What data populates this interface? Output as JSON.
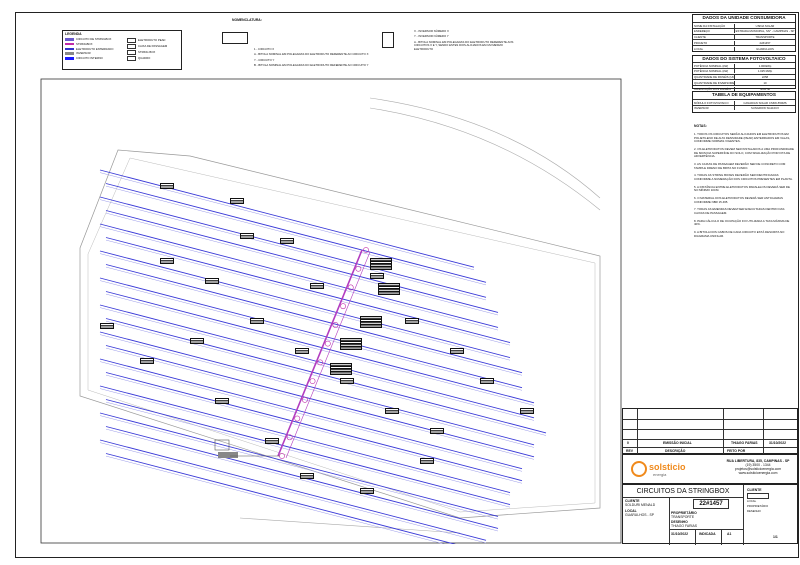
{
  "legend_left": {
    "title": "LEGENDA",
    "items": [
      {
        "color": "#6a5acd",
        "label": "CIRCUITO DE STRINGBOX"
      },
      {
        "color": "#c02aa8",
        "label": "STRINGBOX"
      },
      {
        "color": "#3333cc",
        "label": "ELETRODUTO ENTERRADO"
      },
      {
        "color": "#888888",
        "label": "INVERSOR"
      },
      {
        "color": "#1a1aff",
        "label": "CIRCUITO INTERNO"
      }
    ],
    "items_right": [
      "ELETRODUTO PEAD",
      "CAIXA DE PASSAGEM",
      "STRING BOX",
      "QUADRO"
    ]
  },
  "nomenclature": {
    "title": "NOMENCLATURA:",
    "lines_left": [
      "1 - CIRCUITO X",
      "A - BITOLA NOMINAL EM POLEGADAS DO ELETRODUTO REFERENTE AO CIRCUITO X",
      "Y - CIRCUITO Y",
      "B - BITOLA NOMINAL EM POLEGADAS DO ELETRODUTO REFERENTE AO CIRCUITO Y"
    ],
    "lines_right": [
      "X - INVERSOR NÚMERO X",
      "Y - INVERSOR NÚMERO Y",
      "A - BITOLA NOMINAL EM POLEGADAS DO ELETRODUTO REFERENTE AOS CIRCUITOS X E Y, SENDO ESTES DOIS ALOJADOS EM UM MESMO ELETRODUTO"
    ]
  },
  "consumer_unit": {
    "title": "DADOS DA UNIDADE CONSUMIDORA",
    "rows": [
      [
        "NOME DA INSTALAÇÃO",
        "USINA SOLAR"
      ],
      [
        "ENDEREÇO",
        "ESTRADA MUNICIPAL, SN° - CAMPINAS - SP"
      ],
      [
        "CLIENTE",
        "TRANSPORTE"
      ],
      [
        "PROJETO",
        "22#1457"
      ],
      [
        "LOCAL",
        "GUARULHOS"
      ]
    ]
  },
  "pv_system": {
    "title": "DADOS DO SISTEMA FOTOVOLTAICO",
    "rows": [
      [
        "POTÊNCIA NOMINAL (kW)",
        "1.000kWp"
      ],
      [
        "POTÊNCIA NOMINAL (kW)",
        "1.025 MWp"
      ],
      [
        "QUANTIDADE DE PAINÉIS (UND)",
        "2258"
      ],
      [
        "QUANTIDADE DE INVERSORES",
        "10"
      ],
      [
        "ORIENTAÇÃO DOS PAINÉIS",
        "NORTE"
      ]
    ]
  },
  "equipment": {
    "title": "TABELA DE EQUIPAMENTOS",
    "rows": [
      [
        "MÓDULO FOTOVOLTAICO",
        "CANADIAN SOLAR CS6W-550MS"
      ],
      [
        "INVERSOR",
        "SUNGROW SG110CX"
      ]
    ]
  },
  "notes": {
    "title": "NOTAS:",
    "items": [
      "1. TODOS OS CIRCUITOS SERÃO ALOJADOS EM ELETRODUTOS EM POLIETILENO DE ALTA DENSIDADE (PEAD) ENTERRADOS EM VALAS, CONFORME NORMAS VIGENTES.",
      "2. OS ELETRODUTOS DEVEM SER INSTALADOS A UMA PROFUNDIDADE DE 60CM DA SUPERFÍCIE DO SOLO, COM SINALIZAÇÃO POR FITA DE ADVERTÊNCIA.",
      "3. AS CAIXAS DE PASSAGEM DEVERÃO SER DE CONCRETO COM TAMPA E DRENO DE BRITA NO FUNDO.",
      "4. TODAS AS STRING BOXES DEVERÃO SER IDENTIFICADAS CONFORME A NUMERAÇÃO DOS CIRCUITOS PRESENTES EM PLANTA.",
      "5. A DISTÂNCIA ENTRE ELETRODUTOS PARALELOS DEVERÁ SER DE NO MÍNIMO 10CM.",
      "6. O MATERIAL DOS ELETRODUTOS DEVERÁ SER ANTICHAMAS CONFORME NBR 15.465.",
      "7. TODAS AS EMENDAS DEVEM SER EXECUTADAS DENTRO DAS CAIXAS DE PASSAGEM.",
      "8. PARA CÁLCULO DE OCUPAÇÃO FOI UTILIZADA A TAXA MÁXIMA DE 40%.",
      "9. A BITOLA DOS CABOS DE CADA CIRCUITO ESTÁ DESCRITA NO DIAGRAMA UNIFILAR."
    ]
  },
  "revision": {
    "cols": [
      "REV",
      "DESCRIÇÃO",
      "FEITO POR",
      "DATA"
    ],
    "col_desc_header": "DESCRIÇÃO",
    "col_by_header": "FEITO POR",
    "row0": {
      "rev": "0",
      "desc": "EMISSÃO INICIAL",
      "by": "THIAGO FARIAS",
      "date": "31/10/2022"
    }
  },
  "company": {
    "name": "solsticio",
    "sub": "energia",
    "address": "RUA LIBERTURA, 835, CAMPINAS - SP",
    "phone": "(19) 3500 - 1344",
    "email": "projetos@solsticioenergia.com",
    "web": "www.solsticioenergia.com"
  },
  "title_block": {
    "title": "CIRCUITOS DA STRINGBOX",
    "project": "22#1457",
    "client_label": "CLIENTE",
    "client": "SOLDURI MENALD",
    "location_label": "LOCAL",
    "location": "GUARULHOS - SP",
    "owner_label": "PROPRIETÁRIO",
    "owner": "TRANSPORTE",
    "drawn_label": "DESENHO",
    "drawn": "THIAGO FARIAS",
    "date": "31/10/2022",
    "scale": "INDICADA",
    "sheet": "A1",
    "page": "1/1"
  }
}
